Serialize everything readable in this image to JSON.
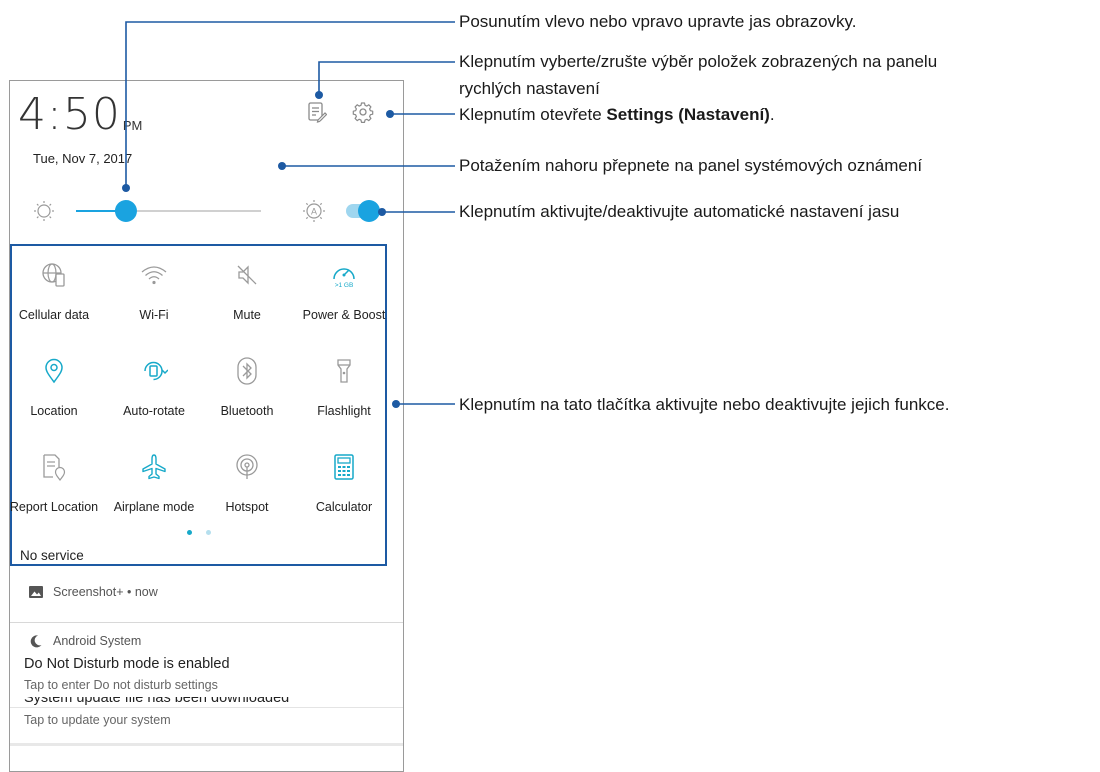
{
  "status": {
    "time": "4:50",
    "ampm": "PM",
    "date": "Tue, Nov 7, 2017"
  },
  "brightness": {
    "level": 0.27,
    "auto_enabled": true
  },
  "tiles": [
    {
      "label": "Cellular data",
      "icon": "globe-phone-icon"
    },
    {
      "label": "Wi-Fi",
      "icon": "wifi-icon"
    },
    {
      "label": "Mute",
      "icon": "mute-icon"
    },
    {
      "label": "Power & Boost",
      "icon": "speedometer-icon",
      "badge": ">1 GB"
    },
    {
      "label": "Location",
      "icon": "location-pin-icon"
    },
    {
      "label": "Auto-rotate",
      "icon": "auto-rotate-icon"
    },
    {
      "label": "Bluetooth",
      "icon": "bluetooth-icon"
    },
    {
      "label": "Flashlight",
      "icon": "flashlight-icon"
    },
    {
      "label": "Report Location",
      "icon": "report-location-icon"
    },
    {
      "label": "Airplane mode",
      "icon": "airplane-icon"
    },
    {
      "label": "Hotspot",
      "icon": "hotspot-icon"
    },
    {
      "label": "Calculator",
      "icon": "calculator-icon"
    }
  ],
  "no_service": "No service",
  "notifications": [
    {
      "app": "Screenshot+ • now",
      "icon": "image-icon"
    },
    {
      "app": "Android System",
      "icon": "moon-icon",
      "title": "Do Not Disturb mode is enabled",
      "text": "Tap to enter Do not disturb settings"
    },
    {
      "title": "System update file has been downloaded",
      "text": "Tap to update your system"
    }
  ],
  "annotations": {
    "brightness": "Posunutím vlevo nebo vpravo upravte jas obrazovky.",
    "edit_line1": "Klepnutím vyberte/zrušte výběr položek zobrazených na panelu",
    "edit_line2": "rychlých nastavení",
    "settings_prefix": "Klepnutím otevřete ",
    "settings_bold": "Settings (Nastavení)",
    "settings_suffix": ".",
    "swipe_up": "Potažením nahoru přepnete na panel systémových oznámení",
    "auto_brightness": "Klepnutím aktivujte/deaktivujte automatické nastavení jasu",
    "tiles": "Klepnutím na tato tlačítka aktivujte nebo deaktivujte jejich funkce."
  },
  "colors": {
    "accent": "#1aa3e0",
    "annotation_line": "#1d5aa3",
    "icon_gray": "#9a9a9a",
    "icon_teal": "#17a9c9"
  }
}
